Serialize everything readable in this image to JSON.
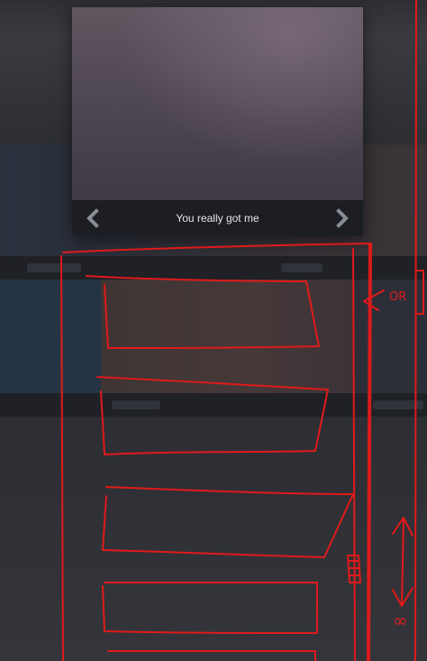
{
  "lightbox": {
    "caption": "You really got me",
    "prev_icon": "chevron-left-icon",
    "next_icon": "chevron-right-icon"
  },
  "sketch": {
    "annotation_or": "OR",
    "annotation_infinity": "∞",
    "color": "#e01a1a"
  },
  "colors": {
    "caption_bar": "#1c1e24",
    "arrow": "#8a8d93"
  }
}
